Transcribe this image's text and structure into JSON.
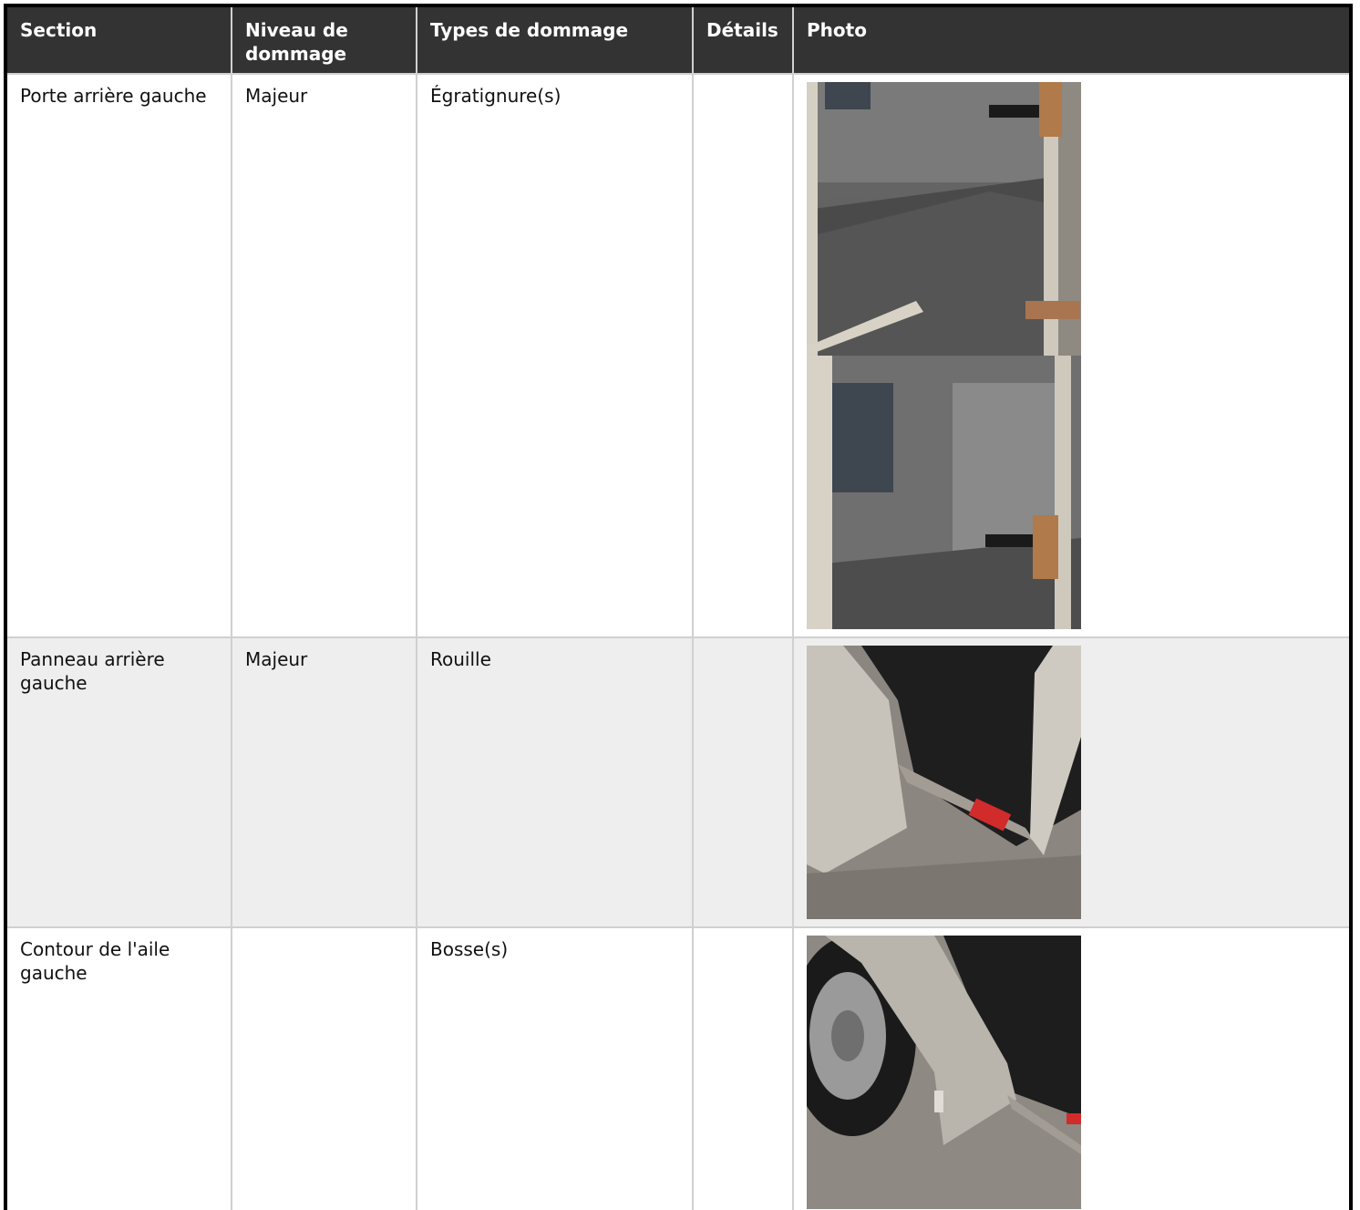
{
  "table": {
    "headers": {
      "section": "Section",
      "level": "Niveau de dommage",
      "types": "Types de dommage",
      "details": "Détails",
      "photo": "Photo"
    },
    "rows": [
      {
        "section": "Porte arrière gauche",
        "level": "Majeur",
        "types": "Égratignure(s)",
        "details": "",
        "photos": [
          "trailer-interior-door-photo",
          "trailer-interior-wall-photo"
        ]
      },
      {
        "section": "Panneau arrière gauche",
        "level": "Majeur",
        "types": "Rouille",
        "details": "",
        "photos": [
          "rear-panel-rust-photo"
        ]
      },
      {
        "section": "Contour de l'aile gauche",
        "level": "",
        "types": "Bosse(s)",
        "details": "",
        "photos": [
          "fender-dent-photo"
        ]
      }
    ]
  }
}
